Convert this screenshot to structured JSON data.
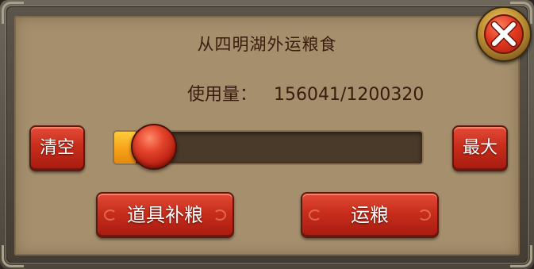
{
  "dialog": {
    "title": "从四明湖外运粮食",
    "usage_label": "使用量：",
    "usage_value": "156041/1200320",
    "clear_label": "清空",
    "max_label": "最大",
    "supplement_label": "道具补粮",
    "transport_label": "运粮",
    "slider_fraction": 0.13
  },
  "colors": {
    "panel": "#a58f6d",
    "button_red": "#c82d1c",
    "slider_fill": "#f7a21a",
    "text_dark": "#3a1c0e"
  },
  "icons": {
    "close": "close-x-icon"
  }
}
